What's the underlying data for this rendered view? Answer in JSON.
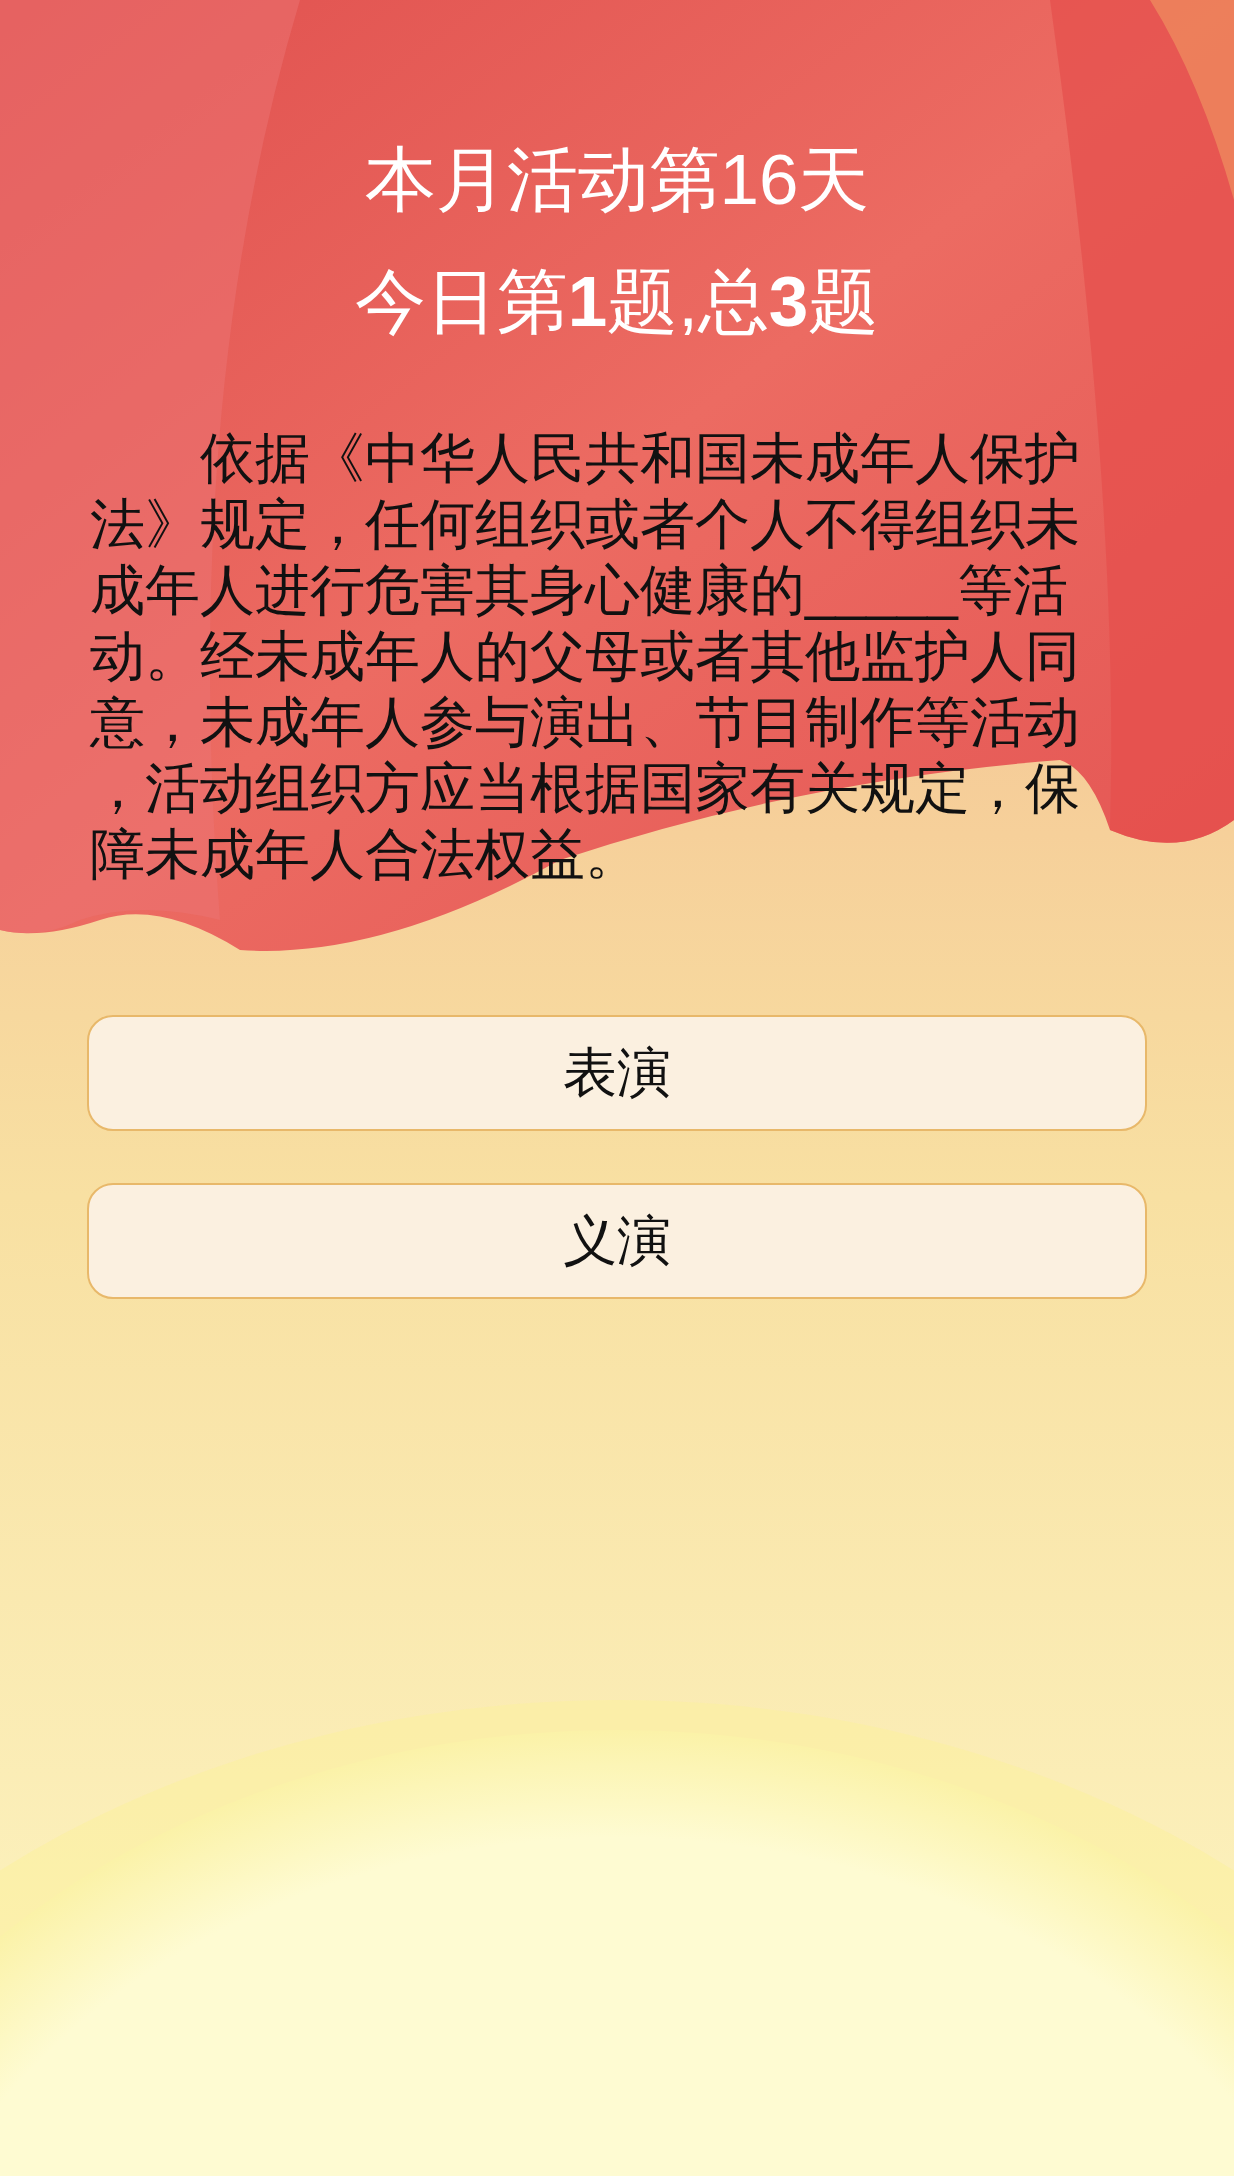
{
  "header": {
    "day_title": "本月活动第16天",
    "progress": "今日第**1**题,总**3**题"
  },
  "question": {
    "before_blank": "依据《中华人民共和国未成年人保护法》规定，任何组织或者个人不得组织未成年人进行危害其身心健康的",
    "blank": "_____",
    "after_blank": "等活动。经未成年人的父母或者其他监护人同意，未成年人参与演出、节目制作等活动，活动组织方应当根据国家有关规定，保障未成年人合法权益。"
  },
  "options": [
    {
      "label": "表演"
    },
    {
      "label": "义演"
    }
  ]
}
